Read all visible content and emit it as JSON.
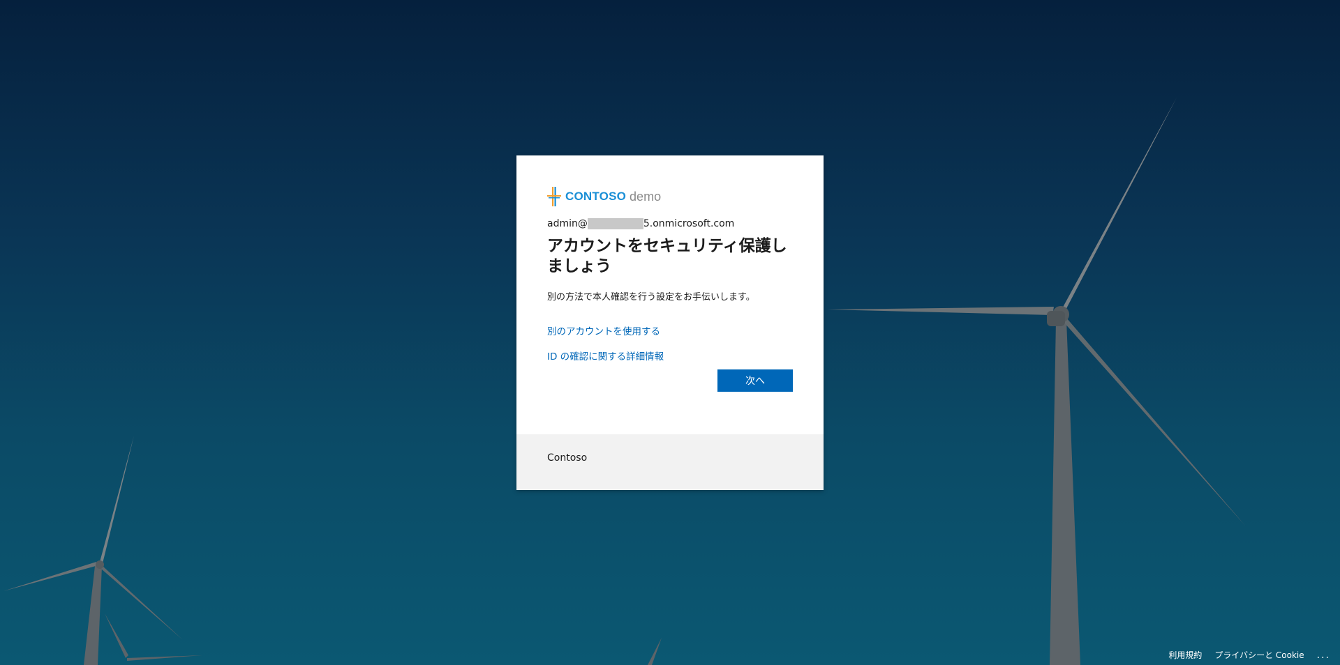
{
  "logo": {
    "brand": "CONTOSO",
    "sub": "demo",
    "colors": {
      "brand": "#1a8fd6",
      "mark_orange": "#f29e2e",
      "mark_blue": "#1a8fd6"
    }
  },
  "identity": {
    "prefix": "admin@",
    "suffix": "5.onmicrosoft.com"
  },
  "title": "アカウントをセキュリティ保護しましょう",
  "description": "別の方法で本人確認を行う設定をお手伝いします。",
  "links": {
    "use_other_account": "別のアカウントを使用する",
    "more_info": "ID の確認に関する詳細情報"
  },
  "next_button": "次へ",
  "footer": {
    "org_name": "Contoso"
  },
  "page_footer": {
    "terms": "利用規約",
    "privacy": "プライバシーと Cookie",
    "more": "..."
  },
  "colors": {
    "accent": "#0067b8",
    "background_top": "#05203d",
    "background_bottom": "#0b5872"
  }
}
